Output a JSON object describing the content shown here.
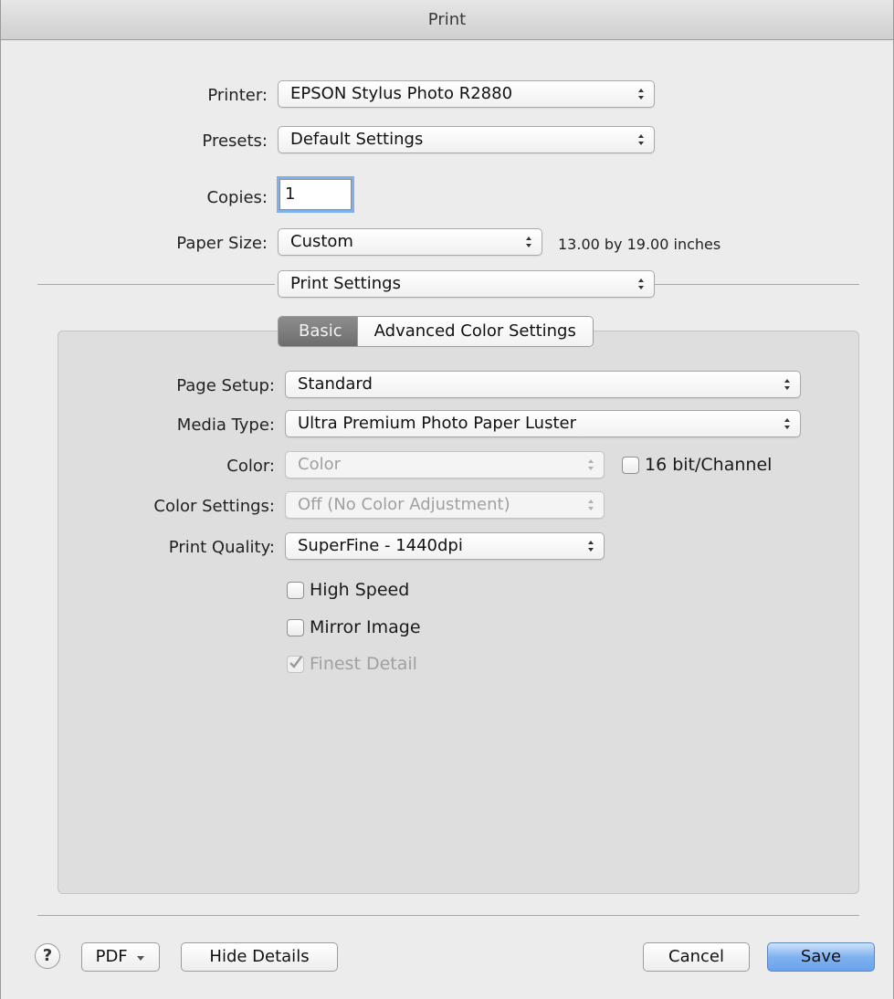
{
  "window": {
    "title": "Print"
  },
  "printer": {
    "label": "Printer:",
    "value": "EPSON Stylus Photo R2880"
  },
  "presets": {
    "label": "Presets:",
    "value": "Default Settings"
  },
  "copies": {
    "label": "Copies:",
    "value": "1"
  },
  "paper_size": {
    "label": "Paper Size:",
    "value": "Custom",
    "info": "13.00 by 19.00 inches"
  },
  "section_menu": {
    "value": "Print Settings"
  },
  "tabs": {
    "basic": "Basic",
    "advanced": "Advanced Color Settings"
  },
  "page_setup": {
    "label": "Page Setup:",
    "value": "Standard"
  },
  "media_type": {
    "label": "Media Type:",
    "value": "Ultra Premium Photo Paper Luster"
  },
  "color": {
    "label": "Color:",
    "value": "Color",
    "enabled": false
  },
  "bit16": {
    "label": "16 bit/Channel",
    "checked": false
  },
  "color_settings": {
    "label": "Color Settings:",
    "value": "Off (No Color Adjustment)",
    "enabled": false
  },
  "print_quality": {
    "label": "Print Quality:",
    "value": "SuperFine - 1440dpi"
  },
  "options": {
    "high_speed": {
      "label": "High Speed",
      "checked": false
    },
    "mirror_image": {
      "label": "Mirror Image",
      "checked": false
    },
    "finest_detail": {
      "label": "Finest Detail",
      "checked": true,
      "enabled": false
    }
  },
  "footer": {
    "help": "?",
    "pdf": "PDF",
    "hide_details": "Hide Details",
    "cancel": "Cancel",
    "save": "Save"
  },
  "icons": {
    "popup_arrows": "updown-arrows-icon",
    "pdf_menu": "triangle-down-icon",
    "checkmark": "checkmark-icon",
    "help": "question-mark-icon"
  },
  "colors": {
    "focus_ring": "#7fb0ee",
    "default_button": "#6aa3ec",
    "selected_tab": "#7a7a7a"
  }
}
